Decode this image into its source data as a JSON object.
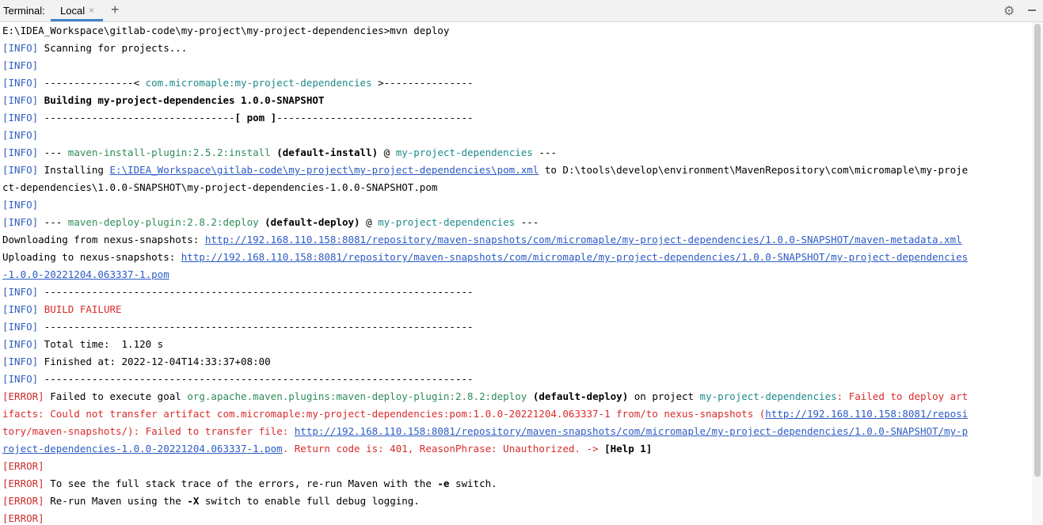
{
  "toolbar": {
    "title": "Terminal:",
    "tab_label": "Local",
    "close_glyph": "×",
    "add_glyph": "+",
    "settings_glyph": "⚙"
  },
  "icons": [
    "close-icon",
    "add-icon",
    "gear-icon",
    "minimize-icon"
  ],
  "colors": {
    "info": "#2f5fbf",
    "error": "#cc2b2b",
    "link": "#2c5cc4",
    "plugin": "#2e8b57",
    "project": "#1f8a8a"
  },
  "console": {
    "l1": "E:\\IDEA_Workspace\\gitlab-code\\my-project\\my-project-dependencies>mvn deploy",
    "l2": {
      "lvl": "[INFO]",
      "text": " Scanning for projects..."
    },
    "l3": {
      "lvl": "[INFO]"
    },
    "l4": {
      "lvl": "[INFO]",
      "a": " ---------------< ",
      "b": "com.micromaple:my-project-dependencies",
      "c": " >---------------"
    },
    "l5": {
      "lvl": "[INFO]",
      "a": " ",
      "b": "Building my-project-dependencies 1.0.0-SNAPSHOT"
    },
    "l6": {
      "lvl": "[INFO]",
      "a": " --------------------------------",
      "b": "[ pom ]",
      "c": "---------------------------------"
    },
    "l7": {
      "lvl": "[INFO]"
    },
    "l8": {
      "lvl": "[INFO]",
      "a": " --- ",
      "b": "maven-install-plugin:2.5.2:install",
      "c": " ",
      "d": "(default-install)",
      "e": " @ ",
      "f": "my-project-dependencies",
      "g": " ---"
    },
    "l9": {
      "lvl": "[INFO]",
      "a": " Installing ",
      "b": "E:\\IDEA_Workspace\\gitlab-code\\my-project\\my-project-dependencies\\pom.xml",
      "c": " to D:\\tools\\develop\\environment\\MavenRepository\\com\\micromaple\\my-proje"
    },
    "l10": "ct-dependencies\\1.0.0-SNAPSHOT\\my-project-dependencies-1.0.0-SNAPSHOT.pom",
    "l11": {
      "lvl": "[INFO]"
    },
    "l12": {
      "lvl": "[INFO]",
      "a": " --- ",
      "b": "maven-deploy-plugin:2.8.2:deploy",
      "c": " ",
      "d": "(default-deploy)",
      "e": " @ ",
      "f": "my-project-dependencies",
      "g": " ---"
    },
    "l13": {
      "a": "Downloading from nexus-snapshots: ",
      "b": "http://192.168.110.158:8081/repository/maven-snapshots/com/micromaple/my-project-dependencies/1.0.0-SNAPSHOT/maven-metadata.xml"
    },
    "l14": {
      "a": "Uploading to nexus-snapshots: ",
      "b": "http://192.168.110.158:8081/repository/maven-snapshots/com/micromaple/my-project-dependencies/1.0.0-SNAPSHOT/my-project-dependencies"
    },
    "l15": "-1.0.0-20221204.063337-1.pom",
    "l16": {
      "lvl": "[INFO]",
      "text": " ------------------------------------------------------------------------"
    },
    "l17": {
      "lvl": "[INFO]",
      "a": " ",
      "b": "BUILD FAILURE"
    },
    "l18": {
      "lvl": "[INFO]",
      "text": " ------------------------------------------------------------------------"
    },
    "l19": {
      "lvl": "[INFO]",
      "text": " Total time:  1.120 s"
    },
    "l20": {
      "lvl": "[INFO]",
      "text": " Finished at: 2022-12-04T14:33:37+08:00"
    },
    "l21": {
      "lvl": "[INFO]",
      "text": " ------------------------------------------------------------------------"
    },
    "l22": {
      "lvl": "[ERROR]",
      "a": " Failed to execute goal ",
      "b": "org.apache.maven.plugins:maven-deploy-plugin:2.8.2:deploy",
      "c": " ",
      "d": "(default-deploy)",
      "e": " on project ",
      "f": "my-project-dependencies",
      "g": ": Failed to deploy art"
    },
    "l23": {
      "a": "ifacts: Could not transfer artifact com.micromaple:my-project-dependencies:pom:1.0.0-20221204.063337-1 from/to nexus-snapshots (",
      "b": "http://192.168.110.158:8081/reposi"
    },
    "l24": {
      "a": "tory/maven-snapshots/",
      "b": "): Failed to transfer file: ",
      "c": "http://192.168.110.158:8081/repository/maven-snapshots/com/micromaple/my-project-dependencies/1.0.0-SNAPSHOT/my-p"
    },
    "l25": {
      "a": "roject-dependencies-1.0.0-20221204.063337-1.pom",
      "b": ". Return code is: 401, ReasonPhrase: Unauthorized. -> ",
      "c": "[Help 1]"
    },
    "l26": {
      "lvl": "[ERROR]"
    },
    "l27": {
      "lvl": "[ERROR]",
      "a": " To see the full stack trace of the errors, re-run Maven with the ",
      "b": "-e",
      "c": " switch."
    },
    "l28": {
      "lvl": "[ERROR]",
      "a": " Re-run Maven using the ",
      "b": "-X",
      "c": " switch to enable full debug logging."
    },
    "l29": {
      "lvl": "[ERROR]"
    }
  }
}
